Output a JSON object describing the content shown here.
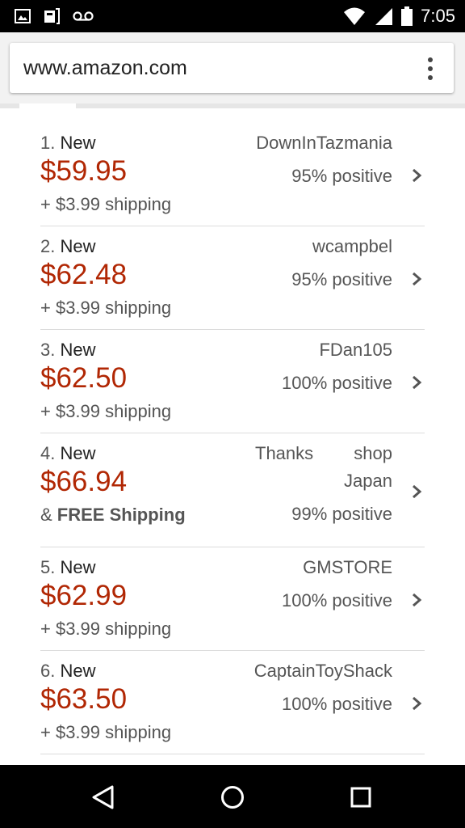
{
  "status_bar": {
    "time": "7:05",
    "left_icons": [
      "image-icon",
      "notification-icon",
      "voicemail-icon"
    ],
    "right_icons": [
      "wifi-icon",
      "signal-icon",
      "battery-icon"
    ]
  },
  "browser": {
    "url": "www.amazon.com",
    "menu_icon": "overflow-menu-icon"
  },
  "colors": {
    "price": "#b12704",
    "text": "#555555"
  },
  "offers": [
    {
      "rank": "1.",
      "condition": "New",
      "price": "$59.95",
      "shipping": "+ $3.99 shipping",
      "seller": "DownInTazmania",
      "rating": "95% positive"
    },
    {
      "rank": "2.",
      "condition": "New",
      "price": "$62.48",
      "shipping": "+ $3.99 shipping",
      "seller": "wcampbel",
      "rating": "95% positive"
    },
    {
      "rank": "3.",
      "condition": "New",
      "price": "$62.50",
      "shipping": "+ $3.99 shipping",
      "seller": "FDan105",
      "rating": "100% positive"
    },
    {
      "rank": "4.",
      "condition": "New",
      "price": "$66.94",
      "shipping_prefix": "& ",
      "shipping_bold": "FREE Shipping",
      "seller": "Thanks shop Japan",
      "rating": "99% positive"
    },
    {
      "rank": "5.",
      "condition": "New",
      "price": "$62.99",
      "shipping": "+ $3.99 shipping",
      "seller": "GMSTORE",
      "rating": "100% positive"
    },
    {
      "rank": "6.",
      "condition": "New",
      "price": "$63.50",
      "shipping": "+ $3.99 shipping",
      "seller": "CaptainToyShack",
      "rating": "100% positive"
    }
  ],
  "nav_bar": {
    "buttons": [
      "back-icon",
      "home-icon",
      "recents-icon"
    ]
  }
}
